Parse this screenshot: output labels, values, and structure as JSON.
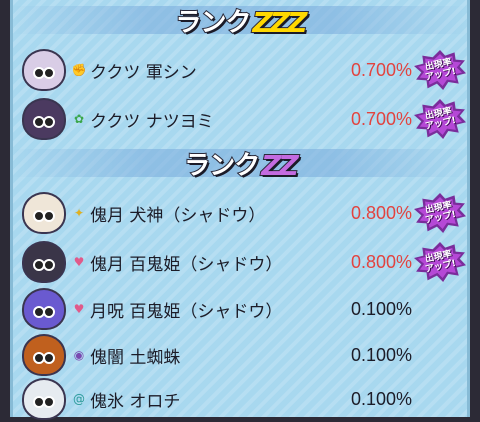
{
  "sections": [
    {
      "rank_label": "ランク",
      "rank_letters": "ZZZ",
      "rank_color": "#ffd800",
      "entries": [
        {
          "name": "ククツ 軍シン",
          "tribe_icon": "fist-icon",
          "rate": "0.700%",
          "boosted": true,
          "avatar_color": "#d9cde6",
          "tribe_color": "#e07a1f"
        },
        {
          "name": "ククツ ナツヨミ",
          "tribe_icon": "clover-icon",
          "rate": "0.700%",
          "boosted": true,
          "avatar_color": "#4b3a60",
          "tribe_color": "#3aa64a"
        }
      ]
    },
    {
      "rank_label": "ランク",
      "rank_letters": "ZZ",
      "rank_color": "#c46be0",
      "entries": [
        {
          "name": "傀月 犬神（シャドウ）",
          "tribe_icon": "bulb-icon",
          "rate": "0.800%",
          "boosted": true,
          "avatar_color": "#efe6d8",
          "tribe_color": "#e0b020"
        },
        {
          "name": "傀月 百鬼姫（シャドウ）",
          "tribe_icon": "heart-icon",
          "rate": "0.800%",
          "boosted": true,
          "avatar_color": "#3a3548",
          "tribe_color": "#e05a8a"
        },
        {
          "name": "月呪 百鬼姫（シャドウ）",
          "tribe_icon": "heart-icon",
          "rate": "0.100%",
          "boosted": false,
          "avatar_color": "#6a5ad0",
          "tribe_color": "#e05a8a"
        },
        {
          "name": "傀闇 土蜘蛛",
          "tribe_icon": "eye-icon",
          "rate": "0.100%",
          "boosted": false,
          "avatar_color": "#c0601e",
          "tribe_color": "#7a4ab0"
        },
        {
          "name": "傀氷 オロチ",
          "tribe_icon": "swirl-icon",
          "rate": "0.100%",
          "boosted": false,
          "avatar_color": "#e6ebf0",
          "tribe_color": "#2a9a9a"
        }
      ]
    }
  ],
  "badge_text": "出現率\nアップ!"
}
